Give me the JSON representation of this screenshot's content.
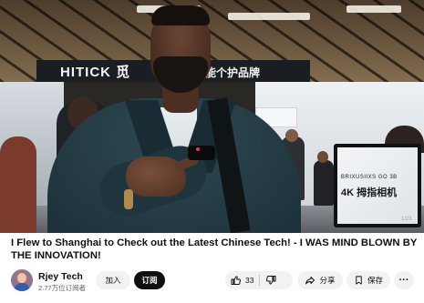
{
  "video": {
    "booth_brand": "HITICK 觅",
    "booth_slogan": "智能个护品牌",
    "monitor_small_text": "BRIXUSIIXS GO 3B",
    "monitor_big_text": "4K 拇指相机",
    "monitor_tag": "1/23"
  },
  "title": "I Flew to Shanghai to Check out the Latest Chinese Tech! - I WAS MIND BLOWN BY THE INNOVATION!",
  "channel": {
    "name": "Rjey Tech",
    "subscribers": "2.77万位订阅者"
  },
  "actions": {
    "join_label": "加入",
    "subscribe_label": "订阅",
    "like_count": "33",
    "share_label": "分享",
    "save_label": "保存",
    "more_label": "···"
  },
  "icons": {
    "like": "thumb-up-icon",
    "dislike": "thumb-down-icon",
    "share": "share-arrow-icon",
    "save": "save-playlist-icon"
  }
}
